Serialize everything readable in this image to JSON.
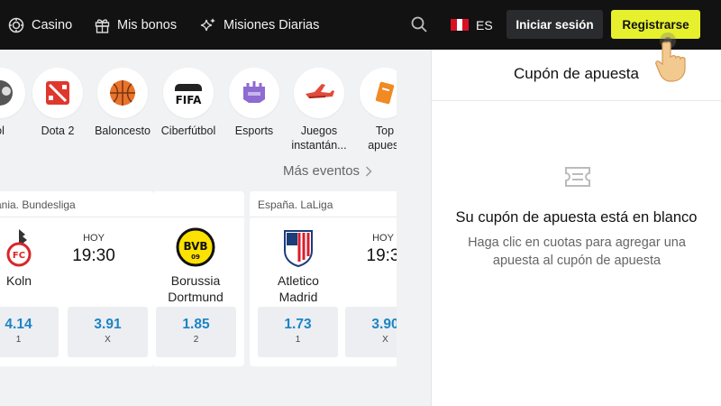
{
  "nav": {
    "casino": "Casino",
    "bonuses": "Mis bonos",
    "missions": "Misiones Diarias",
    "lang": "ES",
    "login": "Iniciar sesión",
    "register": "Registrarse"
  },
  "sports": [
    {
      "label": "ol",
      "icon": "football-icon"
    },
    {
      "label": "Dota 2",
      "icon": "dota2-icon"
    },
    {
      "label": "Baloncesto",
      "icon": "basketball-icon"
    },
    {
      "label": "Ciberfútbol",
      "icon": "fifa-icon"
    },
    {
      "label": "Esports",
      "icon": "esports-icon"
    },
    {
      "label": "Juegos\ninstantán...",
      "icon": "plane-icon"
    },
    {
      "label": "Top\napuest",
      "icon": "ticket-icon"
    }
  ],
  "more_events": "Más eventos",
  "cards": [
    {
      "league": "mania. Bundesliga",
      "home": "Koln",
      "away": "Borussia\nDortmund",
      "when": "HOY",
      "time": "19:30",
      "odds": [
        {
          "value": "4.14",
          "label": "1"
        },
        {
          "value": "3.91",
          "label": "X"
        },
        {
          "value": "1.85",
          "label": "2"
        }
      ]
    },
    {
      "league": "España. LaLiga",
      "home": "Atletico\nMadrid",
      "when": "HOY",
      "time": "19:3",
      "odds": [
        {
          "value": "1.73",
          "label": "1"
        },
        {
          "value": "3.90",
          "label": "X"
        }
      ]
    }
  ],
  "coupon": {
    "title": "Cupón de apuesta",
    "empty_title": "Su cupón de apuesta está en blanco",
    "empty_text": "Haga clic en cuotas para agregar una apuesta al cupón de apuesta"
  },
  "colors": {
    "topbar": "#121212",
    "register_bg": "#e6f02d",
    "odd_value": "#1d84c4",
    "flag_red": "#d91023"
  }
}
